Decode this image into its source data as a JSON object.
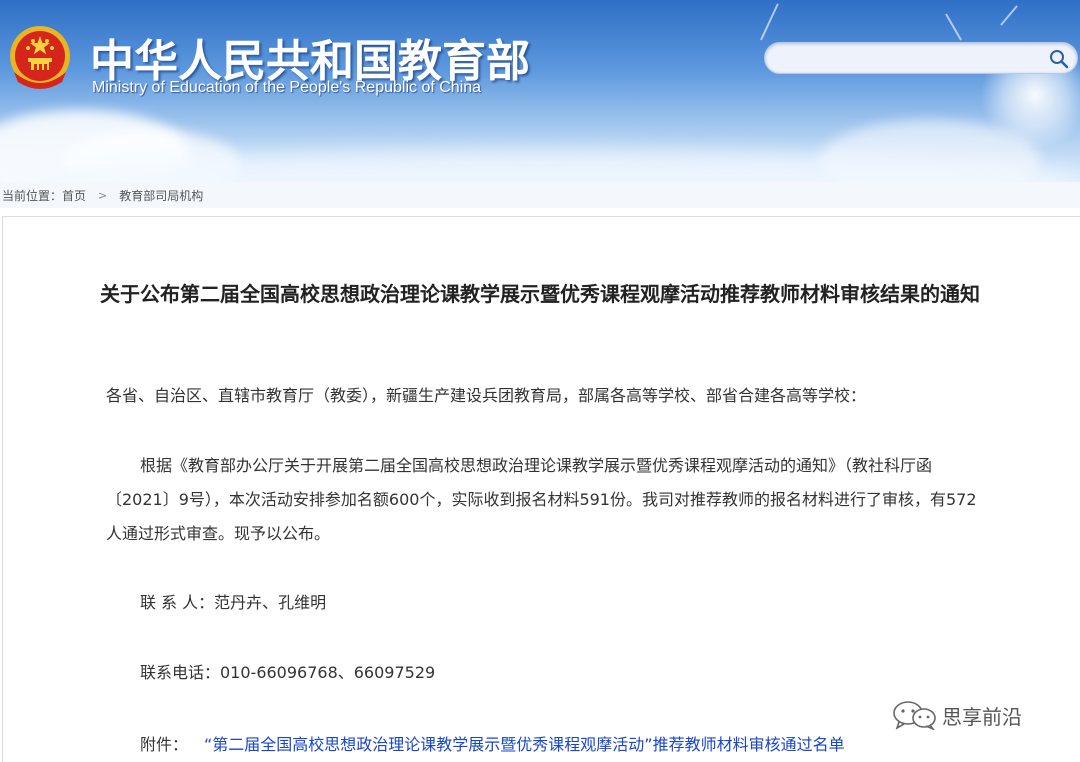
{
  "header": {
    "title_cn": "中华人民共和国教育部",
    "title_en": "Ministry of Education of the People's Republic of China",
    "emblem_icon": "national-emblem-icon",
    "search": {
      "placeholder": "",
      "icon": "search-icon"
    }
  },
  "breadcrumb": {
    "prefix": "当前位置：",
    "items": [
      "首页",
      "教育部司局机构"
    ],
    "separator": ">"
  },
  "article": {
    "title": "关于公布第二届全国高校思想政治理论课教学展示暨优秀课程观摩活动推荐教师材料审核结果的通知",
    "salutation": "各省、自治区、直辖市教育厅（教委），新疆生产建设兵团教育局，部属各高等学校、部省合建各高等学校：",
    "body": "根据《教育部办公厅关于开展第二届全国高校思想政治理论课教学展示暨优秀课程观摩活动的通知》（教社科厅函〔2021〕9号），本次活动安排参加名额600个，实际收到报名材料591份。我司对推荐教师的报名材料进行了审核，有572人通过形式审查。现予以公布。",
    "contact": "联 系 人：范丹卉、孔维明",
    "phone": "联系电话：010-66096768、66097529",
    "attachment_label": "附件：",
    "attachment_link": "“第二届全国高校思想政治理论课教学展示暨优秀课程观摩活动”推荐教师材料审核通过名单"
  },
  "watermark": {
    "text": "思享前沿",
    "icon": "wechat-icon"
  },
  "colors": {
    "header_top": "#2f6fc6",
    "link": "#1a46c8",
    "text": "#333333"
  }
}
